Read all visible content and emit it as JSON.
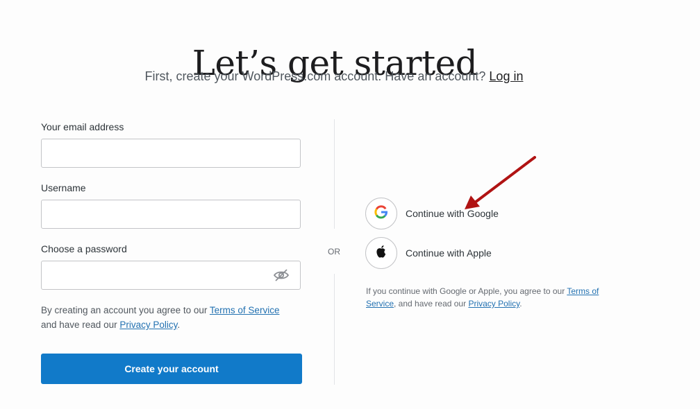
{
  "header": {
    "title": "Let’s get started",
    "subtitle": "First, create your WordPress.com account. Have an account?",
    "login_link": "Log in"
  },
  "form": {
    "email_label": "Your email address",
    "email_value": "",
    "username_label": "Username",
    "username_value": "",
    "password_label": "Choose a password",
    "password_value": "",
    "legal_prefix": "By creating an account you agree to our",
    "terms_link": "Terms of Service",
    "legal_middle": "and have read our",
    "privacy_link": "Privacy Policy",
    "legal_end": ".",
    "submit_label": "Create your account"
  },
  "divider": {
    "or_label": "OR"
  },
  "social": {
    "google_label": "Continue with Google",
    "apple_label": "Continue with Apple",
    "legal_prefix": "If you continue with Google or Apple, you agree to our",
    "terms_link": "Terms of Service",
    "legal_middle": ", and have read our",
    "privacy_link": "Privacy Policy",
    "legal_end": "."
  },
  "icons": {
    "password_toggle": "eye-slash-icon",
    "google": "google-logo-icon",
    "apple": "apple-logo-icon",
    "annotation": "red-arrow-annotation"
  },
  "colors": {
    "primary_button": "#117ac9",
    "link": "#2271b1",
    "annotation_arrow": "#b01313"
  }
}
